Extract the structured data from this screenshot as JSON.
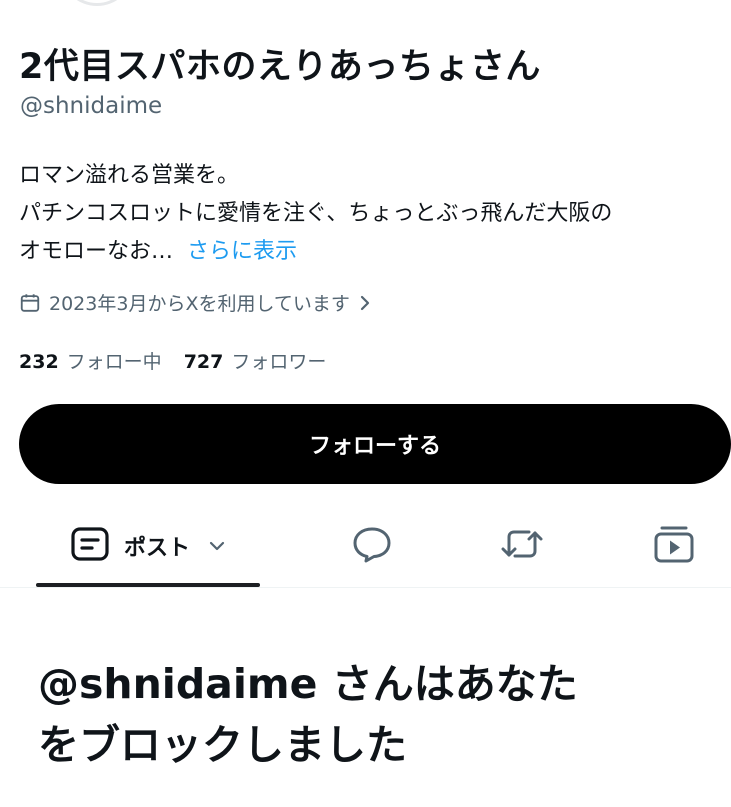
{
  "profile": {
    "display_name": "2代目スパホのえりあっちょさん",
    "handle": "@shnidaime",
    "bio_line1": "ロマン溢れる営業を。",
    "bio_line2": "パチンコスロットに愛情を注ぐ、ちょっとぶっ飛んだ大阪の",
    "bio_line3": "オモローなお…",
    "bio_more": "さらに表示",
    "joined": "2023年3月からXを利用しています",
    "following_count": "232",
    "following_label": "フォロー中",
    "followers_count": "727",
    "followers_label": "フォロワー",
    "follow_button": "フォローする"
  },
  "tabs": {
    "posts_label": "ポスト",
    "icons": [
      "posts-icon",
      "reply-icon",
      "repost-icon",
      "media-icon"
    ]
  },
  "blocked_message": {
    "line1": "@shnidaime さんはあなた",
    "line2": "をブロックしました"
  },
  "colors": {
    "text_primary": "#0f1419",
    "text_secondary": "#536471",
    "link": "#1d9bf0",
    "button_bg": "#000000"
  }
}
